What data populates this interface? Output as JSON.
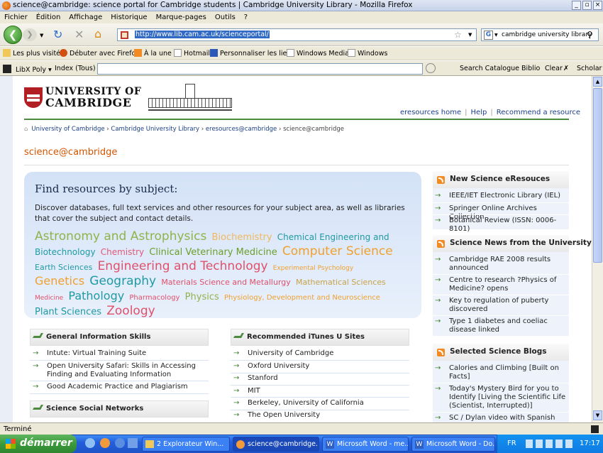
{
  "window": {
    "title": "science@cambridge: science portal for Cambridge students | Cambridge University Library - Mozilla Firefox"
  },
  "menu": [
    "Fichier",
    "Édition",
    "Affichage",
    "Historique",
    "Marque-pages",
    "Outils",
    "?"
  ],
  "nav": {
    "url": "http://www.lib.cam.ac.uk/scienceportal/",
    "search_value": "cambridge university library"
  },
  "bookmarks": [
    "Les plus visités",
    "Débuter avec Firefox",
    "À la une",
    "Hotmail",
    "Personnaliser les liens",
    "Windows Media",
    "Windows"
  ],
  "libx": {
    "label": "LibX Poly",
    "index": "Index (Tous)",
    "search_catalogue": "Search Catalogue Biblio",
    "clear": "Clear",
    "scholar": "Scholar"
  },
  "header": {
    "logo_line1": "UNIVERSITY OF",
    "logo_line2": "CAMBRIDGE",
    "links": [
      "eresources home",
      "Help",
      "Recommend a resource"
    ]
  },
  "breadcrumb": [
    "University of Cambridge",
    "Cambridge University Library",
    "eresources@cambridge",
    "science@cambridge"
  ],
  "page_title": "science@cambridge",
  "find": {
    "heading": "Find resources by subject:",
    "text": "Discover databases, full text services and other resources for your subject area, as well as libraries that cover the subject and contact details.",
    "subjects": [
      {
        "label": "Astronomy and Astrophysics",
        "size": 17,
        "color": "#8fb34a"
      },
      {
        "label": "Biochemistry",
        "size": 13,
        "color": "#f0b860"
      },
      {
        "label": "Chemical Engineering and Biotechnology",
        "size": 12,
        "color": "#1f9aa3"
      },
      {
        "label": "Chemistry",
        "size": 12,
        "color": "#e05a7a"
      },
      {
        "label": "Clinical Veterinary Medicine",
        "size": 13,
        "color": "#6d9e2c"
      },
      {
        "label": "Computer Science",
        "size": 17,
        "color": "#f0a030"
      },
      {
        "label": "Earth Sciences",
        "size": 11,
        "color": "#1f9aa3"
      },
      {
        "label": "Engineering and Technology",
        "size": 17,
        "color": "#e0506a"
      },
      {
        "label": "Experimental Psychology",
        "size": 9,
        "color": "#f0a030"
      },
      {
        "label": "Genetics",
        "size": 16,
        "color": "#f0a030"
      },
      {
        "label": "Geography",
        "size": 17,
        "color": "#1f9aa3"
      },
      {
        "label": "Materials Science and Metallurgy",
        "size": 11,
        "color": "#e0506a"
      },
      {
        "label": "Mathematical Sciences",
        "size": 11,
        "color": "#c9a24a"
      },
      {
        "label": "Medicine",
        "size": 9,
        "color": "#e0506a"
      },
      {
        "label": "Pathology",
        "size": 16,
        "color": "#1f9aa3"
      },
      {
        "label": "Pharmacology",
        "size": 10,
        "color": "#e0506a"
      },
      {
        "label": "Physics",
        "size": 13,
        "color": "#8fb34a"
      },
      {
        "label": "Physiology, Development and Neuroscience",
        "size": 10,
        "color": "#f0a030"
      },
      {
        "label": "Plant Sciences",
        "size": 13,
        "color": "#1f9aa3"
      },
      {
        "label": "Zoology",
        "size": 17,
        "color": "#e0506a"
      }
    ]
  },
  "info_skills": {
    "heading": "General Information Skills",
    "items": [
      "Intute: Virtual Training Suite",
      "Open University Safari: Skills in Accessing Finding and Evaluating Information",
      "Good Academic Practice and Plagiarism"
    ]
  },
  "social": {
    "heading": "Science Social Networks"
  },
  "itunes": {
    "heading": "Recommended iTunes U Sites",
    "items": [
      "University of Cambridge",
      "Oxford University",
      "Stanford",
      "MIT",
      "Berkeley, University of California",
      "The Open University"
    ]
  },
  "right": {
    "eresources": {
      "heading": "New Science eResouces",
      "items": [
        "IEEE/IET Electronic Library (IEL)",
        "Springer Online Archives Collection",
        "Botanical Review (ISSN: 0006-8101)"
      ]
    },
    "news": {
      "heading": "Science News from the University",
      "items": [
        "Cambridge RAE 2008 results announced",
        "Centre to research ?Physics of Medicine? opens",
        "Key to regulation of puberty discovered",
        "Type 1 diabetes and coeliac disease linked"
      ]
    },
    "blogs": {
      "heading": "Selected Science Blogs",
      "items": [
        "Calories and Climbing [Built on Facts]",
        "Today's Mystery Bird for you to Identify [Living the Scientific Life (Scientist, Interrupted)]",
        "SC / Dylan video with Spanish subs"
      ]
    }
  },
  "status": "Terminé",
  "taskbar": {
    "start": "démarrer",
    "tasks": [
      "2 Explorateur Win...",
      "science@cambridge...",
      "Microsoft Word - me...",
      "Microsoft Word - Do..."
    ],
    "lang": "FR",
    "clock": "17:17"
  }
}
